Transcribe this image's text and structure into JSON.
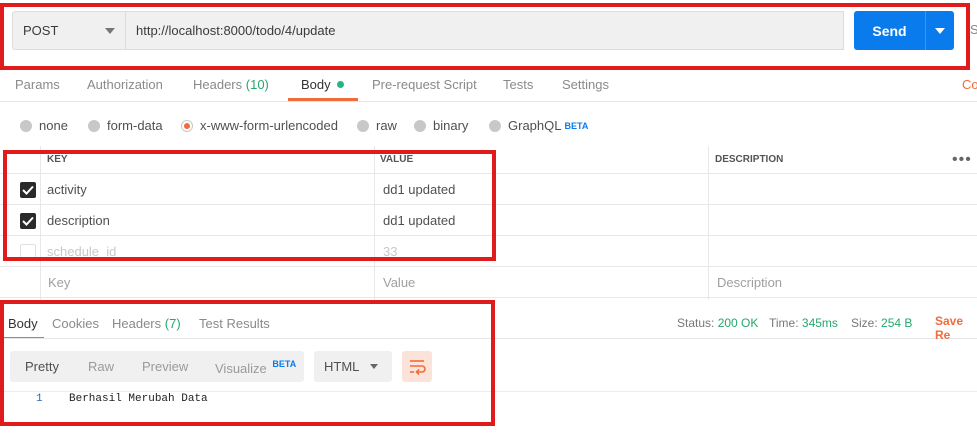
{
  "request": {
    "method": "POST",
    "url": "http://localhost:8000/todo/4/update",
    "send_label": "Send",
    "save_cut": "S"
  },
  "tabs": [
    {
      "label": "Params"
    },
    {
      "label": "Authorization"
    },
    {
      "label": "Headers",
      "count": "(10)"
    },
    {
      "label": "Body"
    },
    {
      "label": "Pre-request Script"
    },
    {
      "label": "Tests"
    },
    {
      "label": "Settings"
    }
  ],
  "cookies_cut": "Co",
  "body_types": [
    {
      "label": "none",
      "selected": false
    },
    {
      "label": "form-data",
      "selected": false
    },
    {
      "label": "x-www-form-urlencoded",
      "selected": true
    },
    {
      "label": "raw",
      "selected": false
    },
    {
      "label": "binary",
      "selected": false
    },
    {
      "label": "GraphQL",
      "badge": "BETA",
      "selected": false
    }
  ],
  "table": {
    "headers": {
      "key": "KEY",
      "value": "VALUE",
      "description": "DESCRIPTION"
    },
    "more": "•••",
    "rows": [
      {
        "key": "activity",
        "value": "dd1 updated",
        "checked": true
      },
      {
        "key": "description",
        "value": "dd1 updated",
        "checked": true
      },
      {
        "key": "schedule_id",
        "value": "33",
        "checked": false
      }
    ],
    "placeholders": {
      "key": "Key",
      "value": "Value",
      "description": "Description"
    }
  },
  "response": {
    "tabs": [
      {
        "label": "Body"
      },
      {
        "label": "Cookies"
      },
      {
        "label": "Headers",
        "count": "(7)"
      },
      {
        "label": "Test Results"
      }
    ],
    "status_label": "Status:",
    "status_value": "200 OK",
    "time_label": "Time:",
    "time_value": "345ms",
    "size_label": "Size:",
    "size_value": "254 B",
    "save_label": "Save Re",
    "formats": [
      "Pretty",
      "Raw",
      "Preview",
      "Visualize"
    ],
    "visualize_badge": "BETA",
    "language": "HTML",
    "line_number": "1",
    "body_text": "Berhasil Merubah Data"
  },
  "colors": {
    "accent": "#f26b3a",
    "send": "#097bed",
    "green": "#25a86b",
    "annotation": "#e01b1b"
  }
}
